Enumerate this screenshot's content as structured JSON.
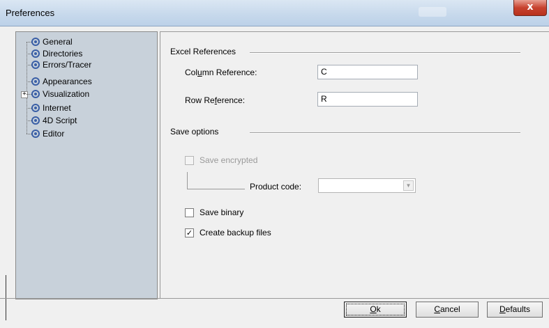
{
  "window": {
    "title": "Preferences",
    "close_glyph": "x"
  },
  "sidebar": {
    "items": [
      {
        "label": "General",
        "icon": "settings-node-icon"
      },
      {
        "label": "Directories",
        "icon": "settings-node-icon"
      },
      {
        "label": "Errors/Tracer",
        "icon": "settings-node-icon"
      },
      {
        "label": "Appearances",
        "icon": "settings-node-icon"
      },
      {
        "label": "Visualization",
        "icon": "settings-node-icon",
        "expandable": true,
        "expander": "+"
      },
      {
        "label": "Internet",
        "icon": "settings-node-icon"
      },
      {
        "label": "4D Script",
        "icon": "settings-node-icon"
      },
      {
        "label": "Editor",
        "icon": "settings-node-icon"
      }
    ]
  },
  "excel_references": {
    "title": "Excel References",
    "column_label_pre": "Col",
    "column_label_u": "u",
    "column_label_post": "mn Reference:",
    "column_value": "C",
    "row_label_pre": "Row Re",
    "row_label_u": "f",
    "row_label_post": "erence:",
    "row_value": "R"
  },
  "save_options": {
    "title": "Save options",
    "save_encrypted_label": "Save encrypted",
    "save_encrypted_checked": false,
    "save_encrypted_enabled": false,
    "product_code_label": "Product code:",
    "product_code_value": "",
    "combo_arrow": "▼",
    "save_binary_label": "Save binary",
    "save_binary_checked": false,
    "create_backup_label": "Create backup files",
    "create_backup_checked": true,
    "check_glyph": "✓"
  },
  "buttons": {
    "ok_u": "O",
    "ok_rest": "k",
    "cancel_u": "C",
    "cancel_rest": "ancel",
    "defaults_u": "D",
    "defaults_rest": "efaults"
  }
}
